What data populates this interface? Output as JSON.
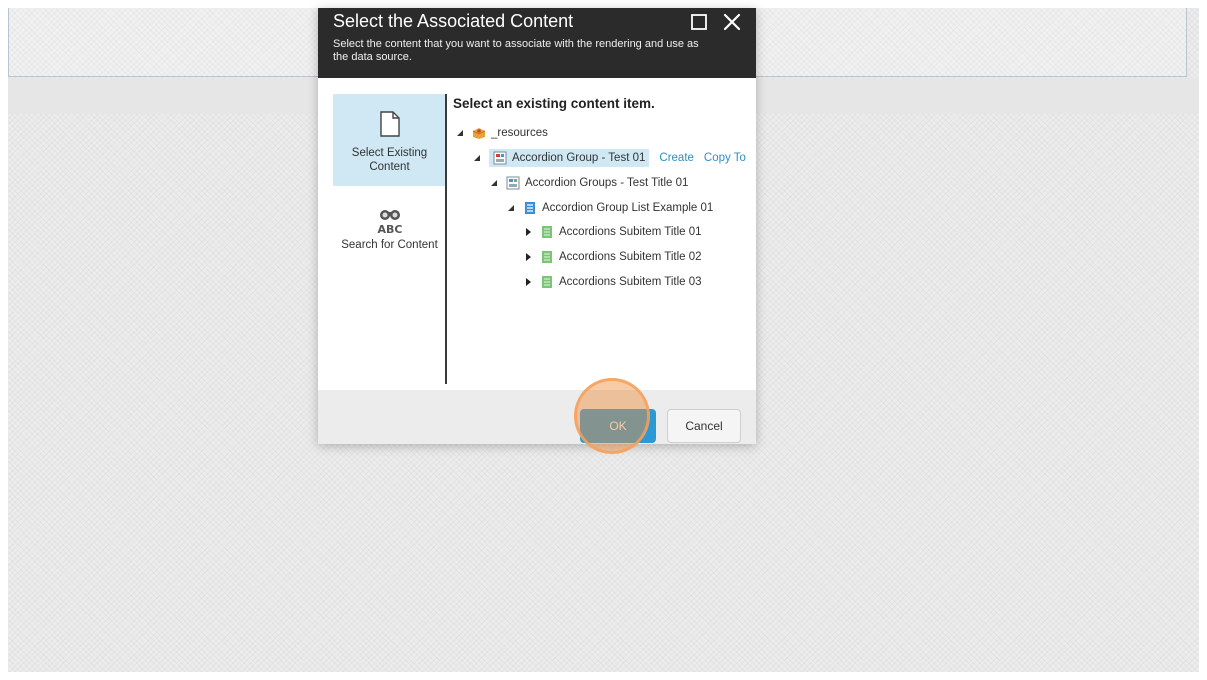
{
  "dialog": {
    "title": "Select the Associated Content",
    "subtitle": "Select the content that you want to associate with the rendering and use as the data source.",
    "maximize_icon": "maximize-icon",
    "close_icon": "close-icon"
  },
  "sidebar": {
    "items": [
      {
        "label": "Select Existing Content",
        "icon": "document-icon",
        "active": true
      },
      {
        "label": "Search for Content",
        "icon": "binoculars-abc-icon",
        "active": false
      }
    ]
  },
  "content": {
    "heading": "Select an existing content item.",
    "tree": [
      {
        "label": "_resources",
        "icon": "resources-icon",
        "expanded": true
      },
      {
        "label": "Accordion Group - Test 01",
        "icon": "component-icon",
        "expanded": true,
        "selected": true,
        "actions": [
          "Create",
          "Copy To"
        ]
      },
      {
        "label": "Accordion Groups - Test Title 01",
        "icon": "component-icon",
        "expanded": true
      },
      {
        "label": "Accordion Group List Example 01",
        "icon": "list-icon",
        "expanded": true
      },
      {
        "label": "Accordions Subitem Title 01",
        "icon": "item-icon",
        "expanded": false
      },
      {
        "label": "Accordions Subitem Title 02",
        "icon": "item-icon",
        "expanded": false
      },
      {
        "label": "Accordions Subitem Title 03",
        "icon": "item-icon",
        "expanded": false
      }
    ]
  },
  "footer": {
    "ok_label": "OK",
    "cancel_label": "Cancel"
  },
  "colors": {
    "accent": "#2b9ad4",
    "selected_bg": "#cfe8f4",
    "header_bg": "#2b2b2b",
    "link": "#2e8fc7",
    "click_highlight": "#f08c3c"
  }
}
